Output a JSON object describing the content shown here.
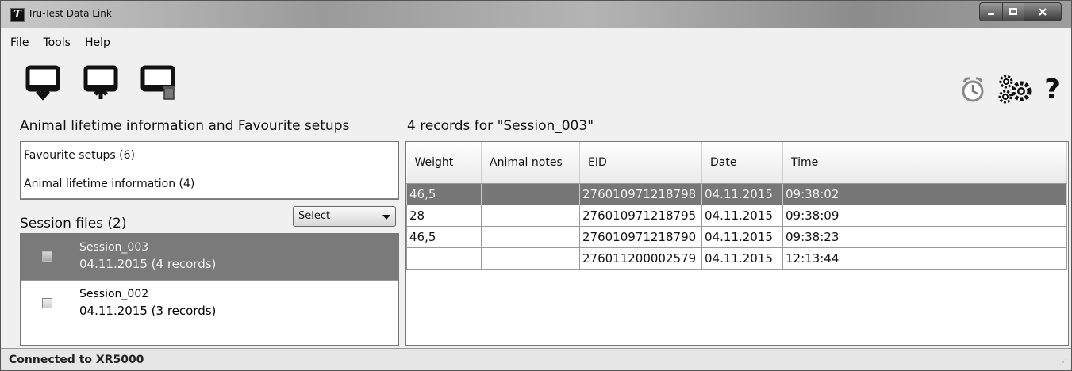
{
  "window": {
    "title": "Tru-Test Data Link",
    "app_icon_letter": "T"
  },
  "menu": [
    "File",
    "Tools",
    "Help"
  ],
  "toolbar": {
    "icons": [
      "download-from-device-icon",
      "upload-to-device-icon",
      "delete-from-device-icon"
    ]
  },
  "right_icons": [
    "alarm-clock-icon",
    "settings-gears-icon"
  ],
  "help_label": "?",
  "left_panel": {
    "heading": "Animal lifetime information and Favourite setups",
    "items": [
      "Favourite setups (6)",
      "Animal lifetime information (4)"
    ]
  },
  "sessions": {
    "heading": "Session files (2)",
    "select_value": "Select",
    "items": [
      {
        "name": "Session_003",
        "meta": "04.11.2015  (4 records)",
        "selected": true
      },
      {
        "name": "Session_002",
        "meta": "04.11.2015  (3 records)",
        "selected": false
      }
    ]
  },
  "records": {
    "heading": "4 records for \"Session_003\"",
    "columns": [
      "Weight",
      "Animal notes",
      "EID",
      "Date",
      "Time"
    ],
    "rows": [
      [
        "46,5",
        "",
        "276010971218798",
        "04.11.2015",
        "09:38:02"
      ],
      [
        "28",
        "",
        "276010971218795",
        "04.11.2015",
        "09:38:09"
      ],
      [
        "46,5",
        "",
        "276010971218790",
        "04.11.2015",
        "09:38:23"
      ],
      [
        "",
        "",
        "276011200002579",
        "04.11.2015",
        "12:13:44"
      ]
    ],
    "selected_row": 0
  },
  "status": {
    "text": "Connected to XR5000"
  },
  "colors": {
    "selection": "#777777",
    "titlebar": "#9a9a9a"
  }
}
